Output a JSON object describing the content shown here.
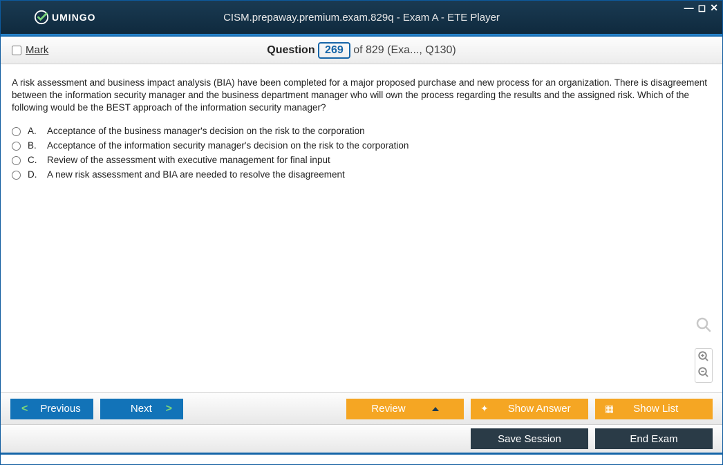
{
  "window": {
    "logo_text": "UMINGO",
    "title": "CISM.prepaway.premium.exam.829q - Exam A - ETE Player"
  },
  "header": {
    "mark_label": "Mark",
    "question_word": "Question",
    "current_number": "269",
    "of_text": "of 829 (Exa..., Q130)"
  },
  "question": {
    "text": "A risk assessment and business impact analysis (BIA) have been completed for a major proposed purchase and new process for an organization. There is disagreement between the information security manager and the business department manager who will own the process regarding the results and the assigned risk. Which of the following would be the BEST approach of the information security manager?",
    "answers": [
      {
        "letter": "A.",
        "text": "Acceptance of the business manager's decision on the risk to the corporation"
      },
      {
        "letter": "B.",
        "text": "Acceptance of the information security manager's decision on the risk to the corporation"
      },
      {
        "letter": "C.",
        "text": "Review of the assessment with executive management for final input"
      },
      {
        "letter": "D.",
        "text": "A new risk assessment and BIA are needed to resolve the disagreement"
      }
    ]
  },
  "footer": {
    "previous": "Previous",
    "next": "Next",
    "review": "Review",
    "show_answer": "Show Answer",
    "show_list": "Show List",
    "save_session": "Save Session",
    "end_exam": "End Exam"
  }
}
